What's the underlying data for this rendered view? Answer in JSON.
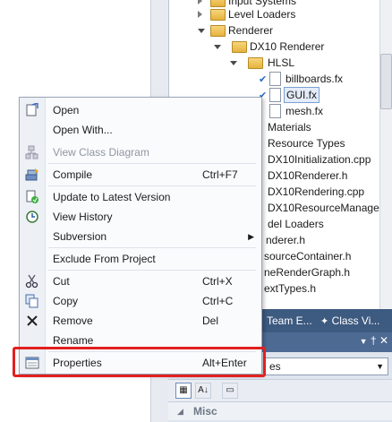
{
  "tree": {
    "items": [
      {
        "label": "Input Systems"
      },
      {
        "label": "Level Loaders"
      },
      {
        "label": "Renderer"
      },
      {
        "label": "DX10 Renderer"
      },
      {
        "label": "HLSL"
      },
      {
        "label": "billboards.fx"
      },
      {
        "label": "GUI.fx"
      },
      {
        "label": "mesh.fx"
      },
      {
        "label": "Materials"
      },
      {
        "label": "Resource Types"
      },
      {
        "label": "DX10Initialization.cpp"
      },
      {
        "label": "DX10Renderer.h"
      },
      {
        "label": "DX10Rendering.cpp"
      },
      {
        "label": "DX10ResourceManage"
      },
      {
        "label": "del Loaders"
      },
      {
        "label": "nderer.h"
      },
      {
        "label": "sourceContainer.h"
      },
      {
        "label": "neRenderGraph.h"
      },
      {
        "label": "extTypes.h"
      }
    ]
  },
  "tabs": {
    "team": "Team E...",
    "class": "Class Vi..."
  },
  "properties": {
    "pin": "†",
    "close": "✕",
    "selector_text": "es",
    "misc": "Misc"
  },
  "menu": {
    "items": [
      {
        "label": "Open",
        "shortcut": "",
        "icon": "open-file-icon"
      },
      {
        "label": "Open With...",
        "shortcut": ""
      },
      {
        "label": "View Class Diagram",
        "shortcut": "",
        "icon": "class-diagram-icon",
        "disabled": true
      },
      {
        "label": "Compile",
        "shortcut": "Ctrl+F7",
        "icon": "compile-icon"
      },
      {
        "label": "Update to Latest Version",
        "shortcut": "",
        "icon": "update-icon"
      },
      {
        "label": "View History",
        "shortcut": "",
        "icon": "history-icon"
      },
      {
        "label": "Subversion",
        "shortcut": "",
        "submenu": true
      },
      {
        "label": "Exclude From Project",
        "shortcut": ""
      },
      {
        "label": "Cut",
        "shortcut": "Ctrl+X",
        "icon": "cut-icon"
      },
      {
        "label": "Copy",
        "shortcut": "Ctrl+C",
        "icon": "copy-icon"
      },
      {
        "label": "Remove",
        "shortcut": "Del",
        "icon": "remove-icon"
      },
      {
        "label": "Rename",
        "shortcut": ""
      },
      {
        "label": "Properties",
        "shortcut": "Alt+Enter",
        "icon": "properties-icon"
      }
    ]
  },
  "colors": {
    "highlight": "#e2201f",
    "tab_bar": "#3d5a80"
  }
}
